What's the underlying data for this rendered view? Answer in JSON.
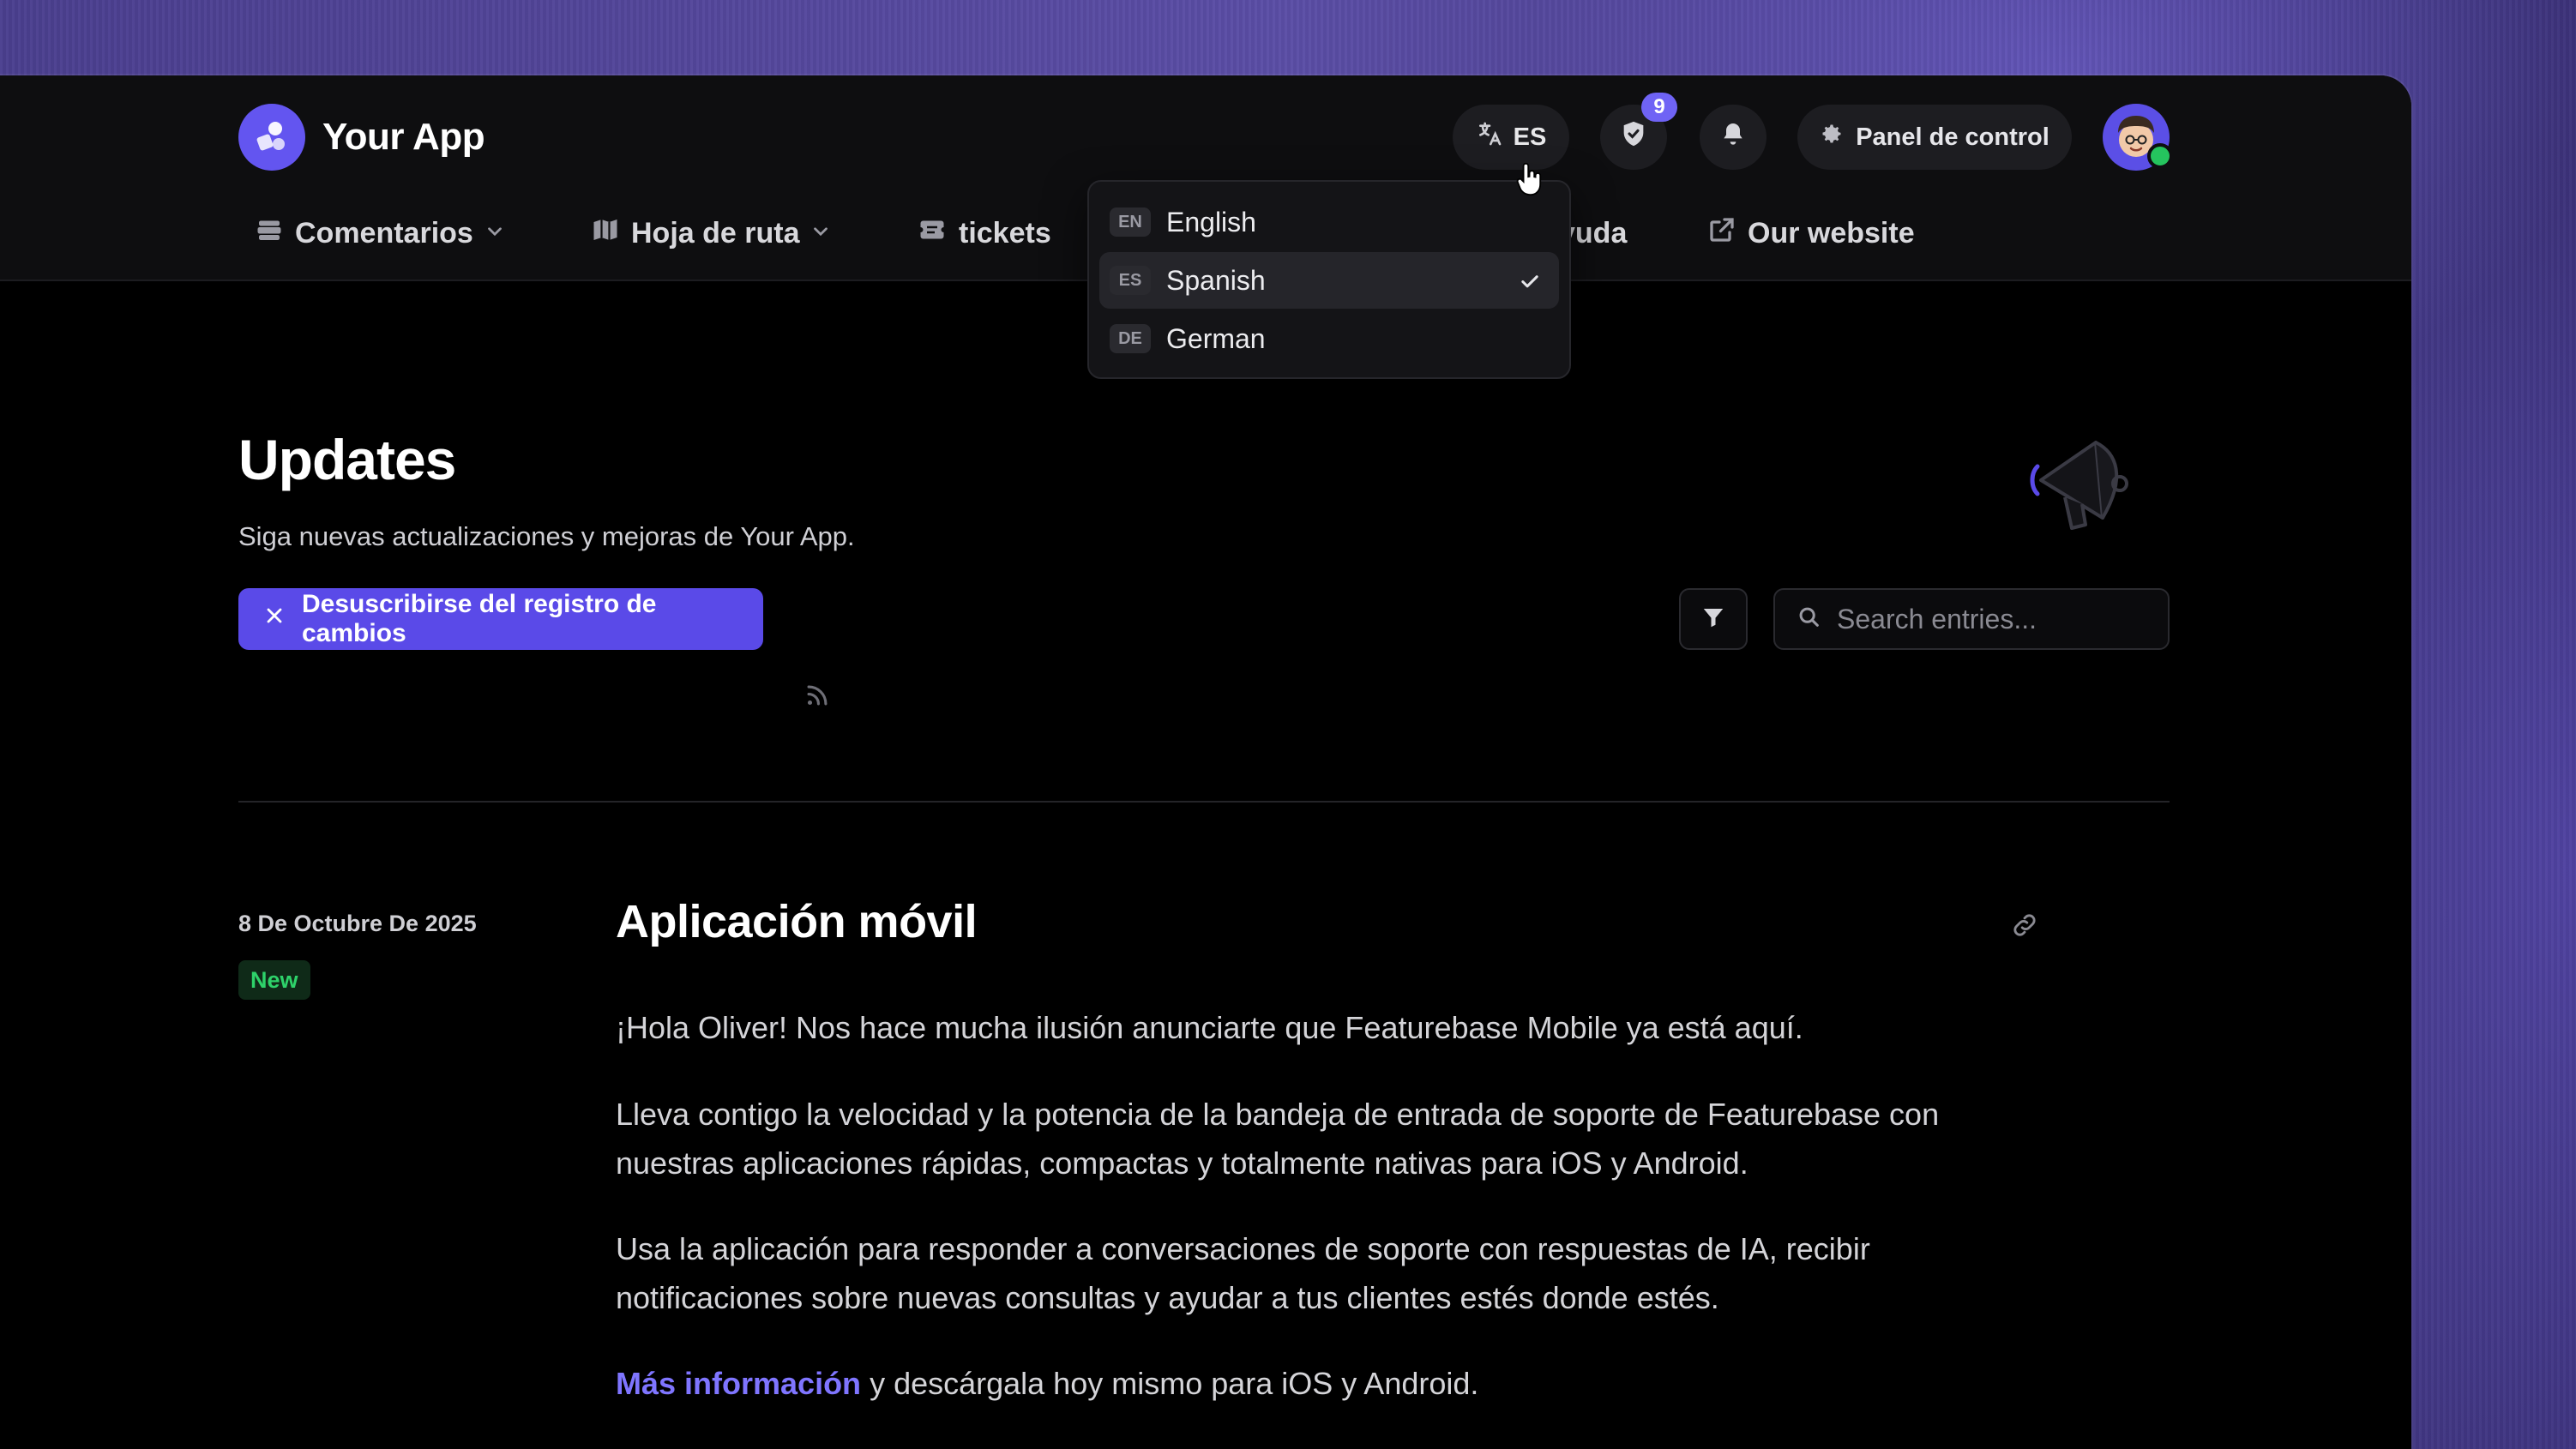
{
  "app": {
    "name": "Your App"
  },
  "header": {
    "language_code": "ES",
    "notification_count": "9",
    "dashboard_label": "Panel de control"
  },
  "nav": {
    "items": [
      {
        "label": "Comentarios"
      },
      {
        "label": "Hoja de ruta"
      },
      {
        "label": "tickets"
      },
      {
        "label": "yuda"
      },
      {
        "label": "Our website"
      }
    ]
  },
  "language_menu": {
    "options": [
      {
        "code": "EN",
        "label": "English",
        "selected": false
      },
      {
        "code": "ES",
        "label": "Spanish",
        "selected": true
      },
      {
        "code": "DE",
        "label": "German",
        "selected": false
      }
    ]
  },
  "hero": {
    "title": "Updates",
    "subtitle": "Siga nuevas actualizaciones y mejoras de Your App.",
    "unsubscribe_label": "Desuscribirse del registro de cambios",
    "search_placeholder": "Search entries..."
  },
  "entry": {
    "date": "8 De Octubre De 2025",
    "badge": "New",
    "title": "Aplicación móvil",
    "paragraphs": [
      "¡Hola Oliver! Nos hace mucha ilusión anunciarte que Featurebase Mobile ya está aquí.",
      "Lleva contigo la velocidad y la potencia de la bandeja de entrada de soporte de Featurebase con nuestras aplicaciones rápidas, compactas y totalmente nativas para iOS y Android.",
      "Usa la aplicación para responder a conversaciones de soporte con respuestas de IA, recibir notificaciones sobre nuevas consultas y ayudar a tus clientes estés donde estés."
    ],
    "last_paragraph_link": "Más información",
    "last_paragraph_rest": " y descárgala hoy mismo para iOS y Android."
  },
  "colors": {
    "accent": "#5a4ae8",
    "badge_green": "#2ed26a",
    "online": "#25c45e"
  }
}
